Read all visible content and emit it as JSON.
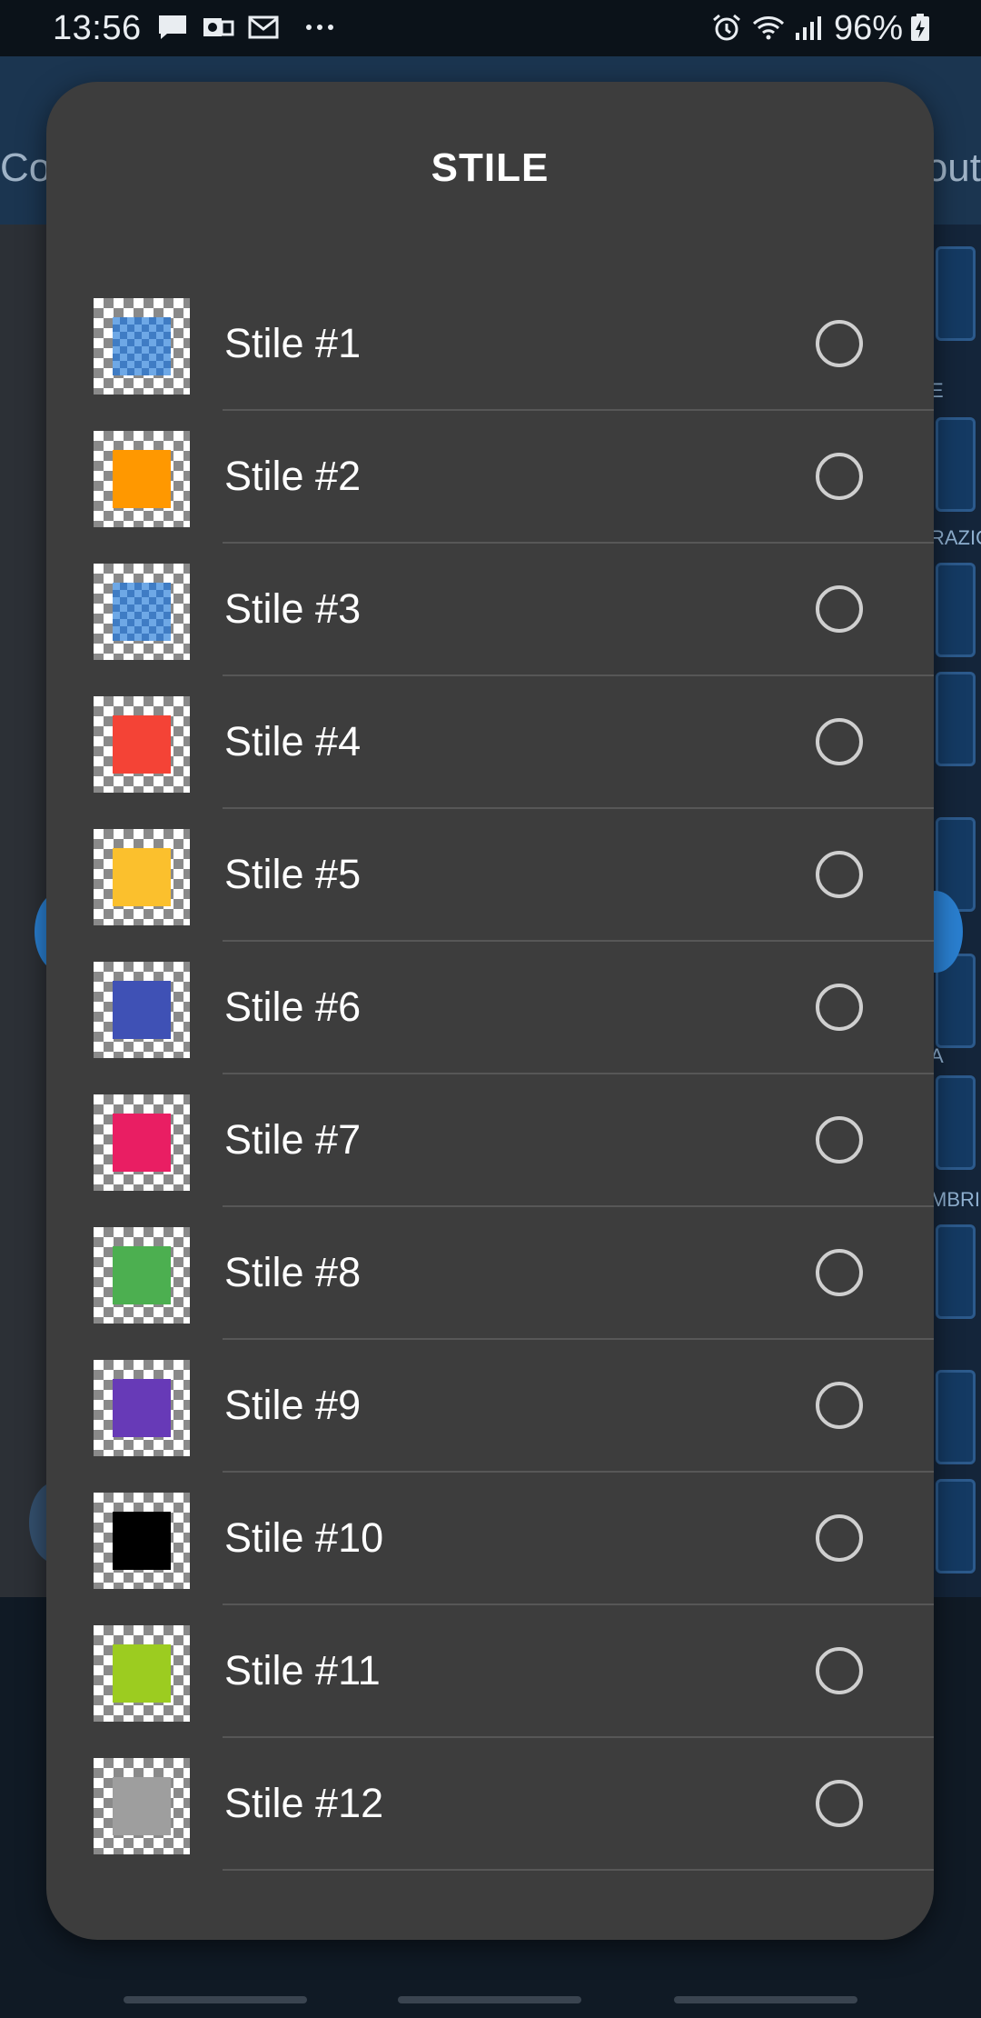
{
  "status_bar": {
    "time": "13:56",
    "left_icons": [
      "message-icon",
      "outlook-icon",
      "gmail-icon",
      "more-dots-icon"
    ],
    "right_icons": [
      "alarm-icon",
      "wifi-icon",
      "signal-icon",
      "battery-charging-icon"
    ],
    "battery": "96%"
  },
  "background": {
    "header_left_text": "Co",
    "header_right_text": "out",
    "tags": [
      "E",
      "RAZIO",
      "A",
      "MBRI E"
    ]
  },
  "sheet": {
    "title": "STILE",
    "items": [
      {
        "label": "Stile #1",
        "color": "#6ea8e6",
        "pattern": true,
        "selected": false
      },
      {
        "label": "Stile #2",
        "color": "#ff9800",
        "pattern": false,
        "selected": false
      },
      {
        "label": "Stile #3",
        "color": "#6ea8e6",
        "pattern": true,
        "selected": false
      },
      {
        "label": "Stile #4",
        "color": "#f44336",
        "pattern": false,
        "selected": false
      },
      {
        "label": "Stile #5",
        "color": "#fbc02d",
        "pattern": false,
        "selected": false
      },
      {
        "label": "Stile #6",
        "color": "#3f51b5",
        "pattern": false,
        "selected": false
      },
      {
        "label": "Stile #7",
        "color": "#e91e63",
        "pattern": false,
        "selected": false
      },
      {
        "label": "Stile #8",
        "color": "#4caf50",
        "pattern": false,
        "selected": false
      },
      {
        "label": "Stile #9",
        "color": "#673ab7",
        "pattern": false,
        "selected": false
      },
      {
        "label": "Stile #10",
        "color": "#000000",
        "pattern": false,
        "selected": false
      },
      {
        "label": "Stile #11",
        "color": "#9ccc20",
        "pattern": false,
        "selected": false
      },
      {
        "label": "Stile #12",
        "color": "#9e9e9e",
        "pattern": false,
        "selected": false
      }
    ]
  }
}
